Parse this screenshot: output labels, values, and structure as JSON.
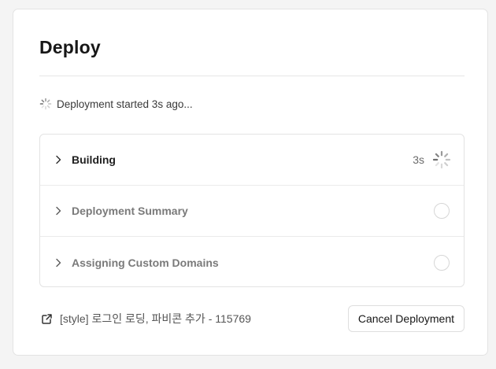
{
  "deploy": {
    "title": "Deploy",
    "status_text": "Deployment started 3s ago...",
    "steps": [
      {
        "label": "Building",
        "time": "3s",
        "state": "in-progress"
      },
      {
        "label": "Deployment Summary",
        "state": "pending"
      },
      {
        "label": "Assigning Custom Domains",
        "state": "pending"
      }
    ],
    "commit_text": "[style] 로그인 로딩, 파비콘 추가 - 115769",
    "cancel_label": "Cancel Deployment"
  },
  "icons": {
    "status": "loading-spinner-icon",
    "step_toggle": "chevron-right-icon",
    "step_in_progress": "loading-spinner-icon",
    "step_pending": "empty-circle-icon",
    "commit_link": "external-link-icon"
  },
  "colors": {
    "primary_text": "#171717",
    "muted_text": "#7a7a7a",
    "border": "#e3e3e3",
    "background": "#f4f4f4"
  }
}
